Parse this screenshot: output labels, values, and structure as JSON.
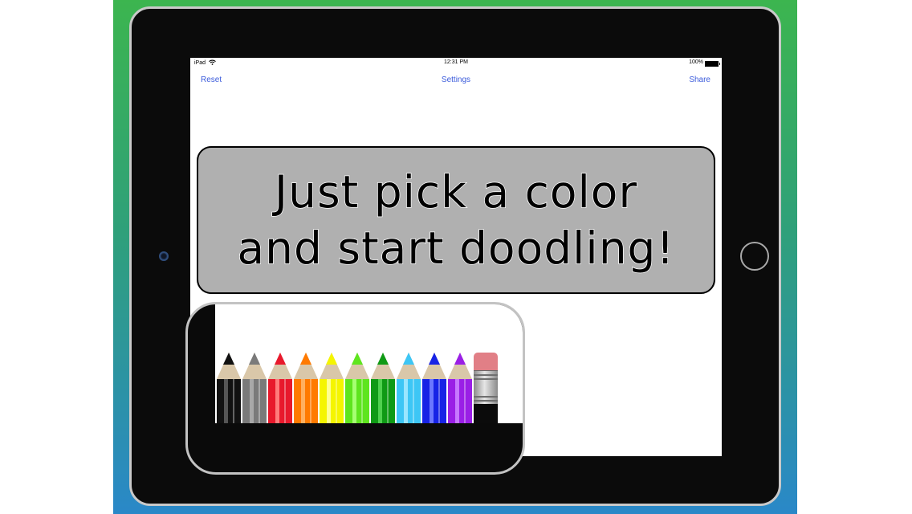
{
  "status_bar": {
    "device": "iPad",
    "time": "12:31 PM",
    "battery": "100%"
  },
  "nav": {
    "reset_label": "Reset",
    "settings_label": "Settings",
    "share_label": "Share"
  },
  "banner": {
    "line1": "Just pick a color",
    "line2": "and start doodling!"
  },
  "pencils": [
    {
      "name": "pencil-black",
      "color": "#111111",
      "light": "#555555"
    },
    {
      "name": "pencil-gray",
      "color": "#7a7a7a",
      "light": "#a8a8a8"
    },
    {
      "name": "pencil-red",
      "color": "#e8192c",
      "light": "#ff7b7b"
    },
    {
      "name": "pencil-orange",
      "color": "#ff7a00",
      "light": "#ffb060"
    },
    {
      "name": "pencil-yellow",
      "color": "#f5f500",
      "light": "#ffff90"
    },
    {
      "name": "pencil-light-green",
      "color": "#5ee51e",
      "light": "#a6ff72"
    },
    {
      "name": "pencil-green",
      "color": "#0f9a15",
      "light": "#4fd14f"
    },
    {
      "name": "pencil-light-blue",
      "color": "#3dc6f5",
      "light": "#9ae6ff"
    },
    {
      "name": "pencil-blue",
      "color": "#1723e6",
      "light": "#6b76ff"
    },
    {
      "name": "pencil-purple",
      "color": "#9a1fe6",
      "light": "#c778ff"
    }
  ],
  "eraser": {
    "name": "eraser",
    "color": "#e17f86"
  }
}
